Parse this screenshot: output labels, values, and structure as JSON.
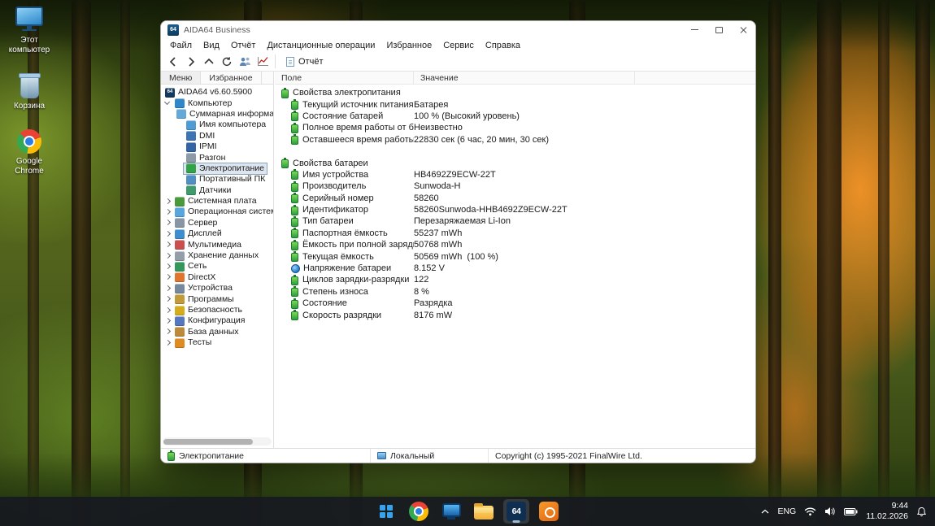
{
  "desktop": {
    "icons": [
      {
        "id": "this-pc",
        "label": "Этот компьютер",
        "icon": "this-pc-icon"
      },
      {
        "id": "recycle-bin",
        "label": "Корзина",
        "icon": "recycle-bin-icon"
      },
      {
        "id": "google-chrome",
        "label": "Google Chrome",
        "icon": "chrome-icon"
      }
    ]
  },
  "window": {
    "title": "AIDA64 Business",
    "logo_text": "64",
    "menu": [
      "Файл",
      "Вид",
      "Отчёт",
      "Дистанционные операции",
      "Избранное",
      "Сервис",
      "Справка"
    ],
    "toolbar": {
      "report": "Отчёт"
    },
    "sidebar": {
      "tabs": [
        "Меню",
        "Избранное"
      ],
      "tree": [
        {
          "id": "root",
          "label": "AIDA64 v6.60.5900",
          "icon": "aida64",
          "level": 0,
          "arrow": "none"
        },
        {
          "id": "computer",
          "label": "Компьютер",
          "icon": "computer",
          "level": 1,
          "arrow": "down"
        },
        {
          "id": "summary",
          "label": "Суммарная информация",
          "icon": "summary",
          "level": 2,
          "arrow": "leaf"
        },
        {
          "id": "computer-name",
          "label": "Имя компьютера",
          "icon": "computer-name",
          "level": 2,
          "arrow": "leaf"
        },
        {
          "id": "dmi",
          "label": "DMI",
          "icon": "dmi",
          "level": 2,
          "arrow": "leaf"
        },
        {
          "id": "ipmi",
          "label": "IPMI",
          "icon": "ipmi",
          "level": 2,
          "arrow": "leaf"
        },
        {
          "id": "overclock",
          "label": "Разгон",
          "icon": "overclock",
          "level": 2,
          "arrow": "leaf"
        },
        {
          "id": "power",
          "label": "Электропитание",
          "icon": "power",
          "level": 2,
          "arrow": "leaf",
          "selected": true
        },
        {
          "id": "portable",
          "label": "Портативный ПК",
          "icon": "portable",
          "level": 2,
          "arrow": "leaf"
        },
        {
          "id": "sensors",
          "label": "Датчики",
          "icon": "sensors",
          "level": 2,
          "arrow": "leaf"
        },
        {
          "id": "motherboard",
          "label": "Системная плата",
          "icon": "motherboard",
          "level": 1,
          "arrow": "right"
        },
        {
          "id": "os",
          "label": "Операционная система",
          "icon": "os",
          "level": 1,
          "arrow": "right"
        },
        {
          "id": "server",
          "label": "Сервер",
          "icon": "server",
          "level": 1,
          "arrow": "right"
        },
        {
          "id": "display",
          "label": "Дисплей",
          "icon": "display",
          "level": 1,
          "arrow": "right"
        },
        {
          "id": "multimedia",
          "label": "Мультимедиа",
          "icon": "multimedia",
          "level": 1,
          "arrow": "right"
        },
        {
          "id": "storage",
          "label": "Хранение данных",
          "icon": "storage",
          "level": 1,
          "arrow": "right"
        },
        {
          "id": "network",
          "label": "Сеть",
          "icon": "network",
          "level": 1,
          "arrow": "right"
        },
        {
          "id": "directx",
          "label": "DirectX",
          "icon": "directx",
          "level": 1,
          "arrow": "right"
        },
        {
          "id": "devices",
          "label": "Устройства",
          "icon": "devices",
          "level": 1,
          "arrow": "right"
        },
        {
          "id": "programs",
          "label": "Программы",
          "icon": "programs",
          "level": 1,
          "arrow": "right"
        },
        {
          "id": "security",
          "label": "Безопасность",
          "icon": "security",
          "level": 1,
          "arrow": "right"
        },
        {
          "id": "config",
          "label": "Конфигурация",
          "icon": "config",
          "level": 1,
          "arrow": "right"
        },
        {
          "id": "database",
          "label": "База данных",
          "icon": "database",
          "level": 1,
          "arrow": "right"
        },
        {
          "id": "tests",
          "label": "Тесты",
          "icon": "tests",
          "level": 1,
          "arrow": "right"
        }
      ]
    },
    "content": {
      "columns": [
        "Поле",
        "Значение"
      ],
      "rows": [
        {
          "type": "group",
          "label": "Свойства электропитания",
          "icon": "battery"
        },
        {
          "type": "item",
          "label": "Текущий источник питания",
          "value": "Батарея",
          "icon": "battery"
        },
        {
          "type": "item",
          "label": "Состояние батарей",
          "value": "100 % (Высокий уровень)",
          "icon": "battery"
        },
        {
          "type": "item",
          "label": "Полное время работы от бата...",
          "value": "Неизвестно",
          "icon": "battery"
        },
        {
          "type": "item",
          "label": "Оставшееся время работы от ...",
          "value": "22830 сек (6 час, 20 мин, 30 сек)",
          "icon": "battery"
        },
        {
          "type": "spacer"
        },
        {
          "type": "group",
          "label": "Свойства батареи",
          "icon": "battery"
        },
        {
          "type": "item",
          "label": "Имя устройства",
          "value": "HB4692Z9ECW-22T",
          "icon": "battery"
        },
        {
          "type": "item",
          "label": "Производитель",
          "value": "Sunwoda-H",
          "icon": "battery"
        },
        {
          "type": "item",
          "label": "Серийный номер",
          "value": "58260",
          "icon": "battery"
        },
        {
          "type": "item",
          "label": "Идентификатор",
          "value": "58260Sunwoda-HHB4692Z9ECW-22T",
          "icon": "battery"
        },
        {
          "type": "item",
          "label": "Тип батареи",
          "value": "Перезаряжаемая Li-Ion",
          "icon": "battery"
        },
        {
          "type": "item",
          "label": "Паспортная ёмкость",
          "value": "55237 mWh",
          "icon": "battery"
        },
        {
          "type": "item",
          "label": "Ёмкость при полной зарядке",
          "value": "50768 mWh",
          "icon": "battery"
        },
        {
          "type": "item",
          "label": "Текущая ёмкость",
          "value": "50569 mWh  (100 %)",
          "icon": "battery"
        },
        {
          "type": "item",
          "label": "Напряжение батареи",
          "value": "8.152 V",
          "icon": "voltage"
        },
        {
          "type": "item",
          "label": "Циклов зарядки-разрядки",
          "value": "122",
          "icon": "battery"
        },
        {
          "type": "item",
          "label": "Степень износа",
          "value": "8 %",
          "icon": "battery"
        },
        {
          "type": "item",
          "label": "Состояние",
          "value": "Разрядка",
          "icon": "battery"
        },
        {
          "type": "item",
          "label": "Скорость разрядки",
          "value": "8176 mW",
          "icon": "battery"
        }
      ]
    },
    "statusbar": {
      "section": "Электропитание",
      "mode": "Локальный",
      "copyright": "Copyright (c) 1995-2021 FinalWire Ltd."
    }
  },
  "taskbar": {
    "apps": [
      "windows-start-icon",
      "chrome-icon",
      "monitor-app-icon",
      "file-explorer-icon",
      "aida64-icon",
      "orange-app-icon"
    ],
    "tray": {
      "language": "ENG",
      "time": "9:44",
      "date": "11.02.2026"
    }
  },
  "icon_colors": {
    "aida64": "#12395f",
    "computer": "#2f86c8",
    "summary": "#64a9d8",
    "computer-name": "#4f9cd4",
    "dmi": "#3d74b4",
    "ipmi": "#3365a6",
    "overclock": "#8d9aa8",
    "power": "#33a347",
    "portable": "#4f8fc4",
    "sensors": "#3f9a6e",
    "motherboard": "#4a9a3c",
    "os": "#58a6de",
    "server": "#8795a4",
    "display": "#3c8ed0",
    "multimedia": "#cc4f4f",
    "storage": "#939ea9",
    "network": "#36975c",
    "directx": "#e0762e",
    "devices": "#76889c",
    "programs": "#c19a3a",
    "security": "#d4ac1e",
    "config": "#5577bd",
    "database": "#bd8a3c",
    "tests": "#e08a22"
  }
}
